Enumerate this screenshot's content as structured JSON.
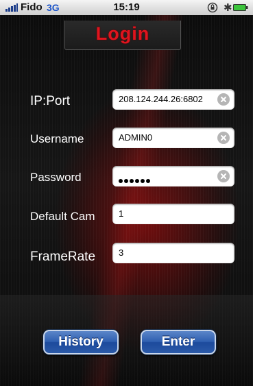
{
  "status_bar": {
    "carrier": "Fido",
    "network": "3G",
    "time": "15:19",
    "icons": [
      "signal-bars-icon",
      "orientation-lock-icon",
      "bluetooth-icon",
      "battery-icon"
    ]
  },
  "header": {
    "title": "Login"
  },
  "form": {
    "rows": [
      {
        "label": "IP:Port",
        "value": "208.124.244.26:6802",
        "clearable": true
      },
      {
        "label": "Username",
        "value": "ADMIN0",
        "clearable": true
      },
      {
        "label": "Password",
        "masked_length": 6,
        "clearable": true
      },
      {
        "label": "Default Cam",
        "value": "1",
        "clearable": false
      },
      {
        "label": "FrameRate",
        "value": "3",
        "clearable": false
      }
    ]
  },
  "buttons": {
    "history_label": "History",
    "enter_label": "Enter"
  },
  "colors": {
    "title_red": "#e0141e",
    "button_blue": "#2f5fb0",
    "network_blue": "#1a53c9"
  }
}
